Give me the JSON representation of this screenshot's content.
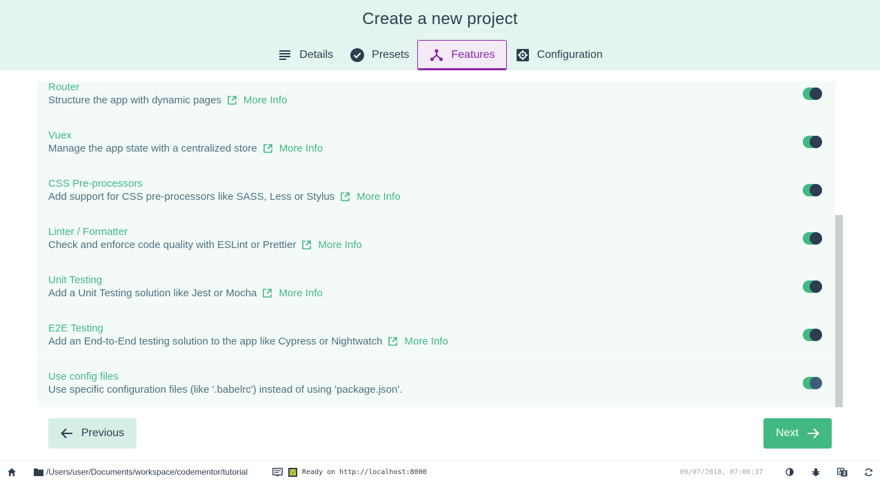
{
  "header": {
    "title": "Create a new project",
    "tabs": [
      {
        "label": "Details",
        "icon": "list-icon"
      },
      {
        "label": "Presets",
        "icon": "check-circle-icon"
      },
      {
        "label": "Features",
        "icon": "fork-icon",
        "active": true
      },
      {
        "label": "Configuration",
        "icon": "gear-icon"
      }
    ]
  },
  "features": [
    {
      "name": "Router",
      "description": "Structure the app with dynamic pages",
      "link": "More Info",
      "enabled": true
    },
    {
      "name": "Vuex",
      "description": "Manage the app state with a centralized store",
      "link": "More Info",
      "enabled": true
    },
    {
      "name": "CSS Pre-processors",
      "description": "Add support for CSS pre-processors like SASS, Less or Stylus",
      "link": "More Info",
      "enabled": true
    },
    {
      "name": "Linter / Formatter",
      "description": "Check and enforce code quality with ESLint or Prettier",
      "link": "More Info",
      "enabled": true
    },
    {
      "name": "Unit Testing",
      "description": "Add a Unit Testing solution like Jest or Mocha",
      "link": "More Info",
      "enabled": true
    },
    {
      "name": "E2E Testing",
      "description": "Add an End-to-End testing solution to the app like Cypress or Nightwatch",
      "link": "More Info",
      "enabled": true
    },
    {
      "name": "Use config files",
      "description": "Use specific configuration files (like '.babelrc') instead of using 'package.json'.",
      "enabled": true
    }
  ],
  "actions": {
    "previous_label": "Previous",
    "next_label": "Next"
  },
  "statusbar": {
    "path": "/Users/user/Documents/workspace/codementor/tutorial",
    "log": "Ready on http://localhost:8000",
    "datetime": "09/07/2018, 07:06:37"
  },
  "colors": {
    "accent": "#42b983",
    "active_tab": "#8e24aa",
    "header_bg": "#e4f5ef"
  }
}
